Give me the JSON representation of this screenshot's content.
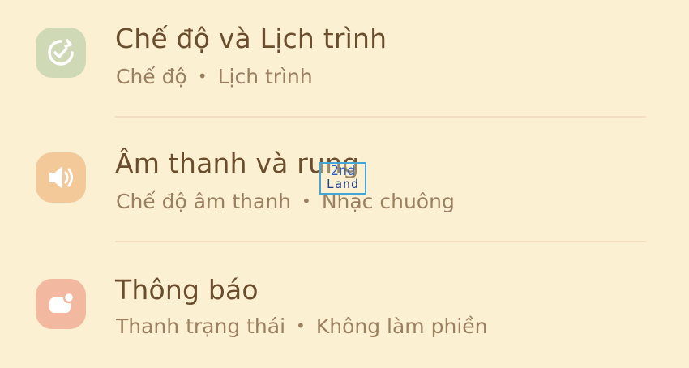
{
  "colors": {
    "background": "#fbf0d2",
    "title_text": "#6a4d2c",
    "subtitle_text": "#9a8060",
    "divider": "#f3dfbf",
    "icon_modes": "#cfd9b6",
    "icon_sound": "#f3c99a",
    "icon_notifications": "#f3b8a0"
  },
  "items": [
    {
      "icon": "modes-routines-check-icon",
      "title": "Chế độ và Lịch trình",
      "subtitle_parts": [
        "Chế độ",
        "Lịch trình"
      ],
      "separator": "•"
    },
    {
      "icon": "speaker-volume-icon",
      "title": "Âm thanh và rung",
      "subtitle_parts": [
        "Chế độ âm thanh",
        "Nhạc chuông"
      ],
      "separator": "•"
    },
    {
      "icon": "notification-badge-icon",
      "title": "Thông báo",
      "subtitle_parts": [
        "Thanh trạng thái",
        "Không làm phiền"
      ],
      "separator": "•"
    }
  ],
  "watermark": {
    "line1": "2nd",
    "line2": "Land"
  }
}
